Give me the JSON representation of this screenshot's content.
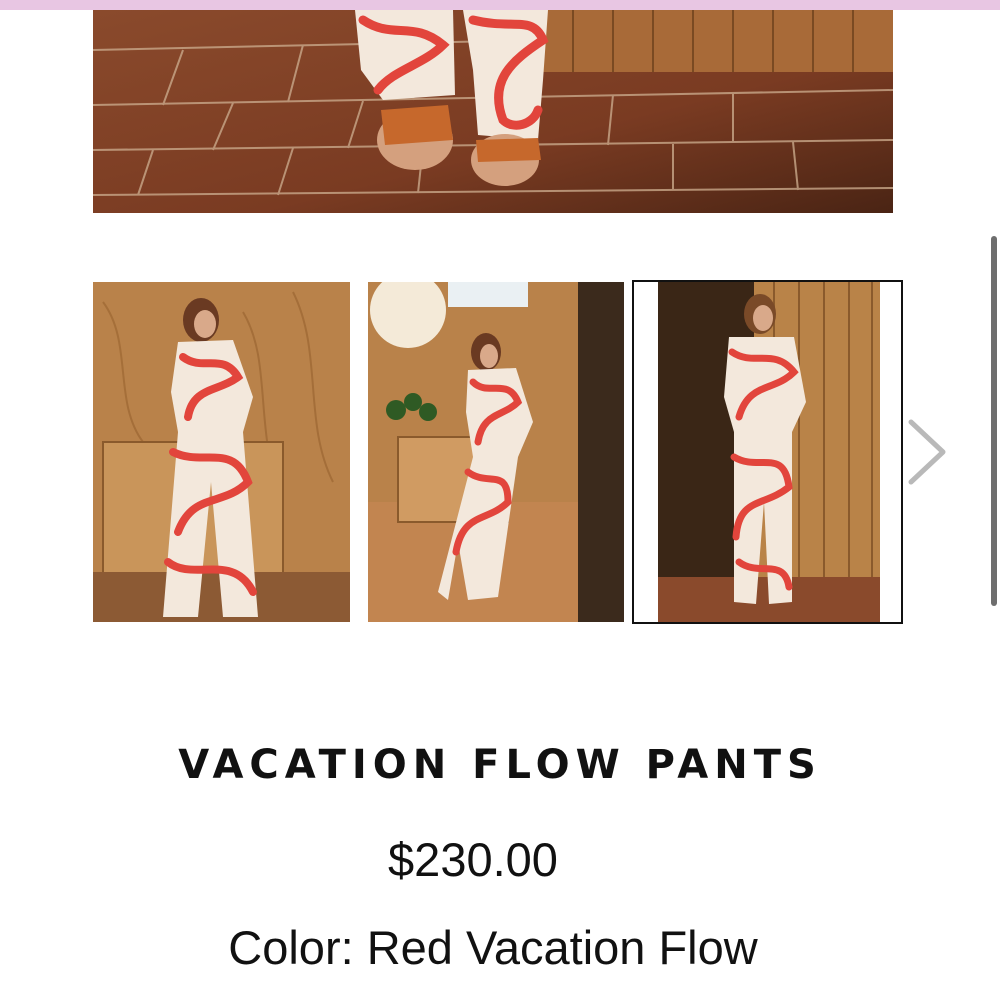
{
  "product": {
    "title": "VACATION FLOW PANTS",
    "price": "$230.00",
    "color_label": "Color:",
    "color_value": "Red Vacation Flow"
  },
  "gallery": {
    "selected_index": 2,
    "next_icon": "chevron-right-icon",
    "thumbnails": [
      {
        "name": "thumbnail-1"
      },
      {
        "name": "thumbnail-2"
      },
      {
        "name": "thumbnail-3"
      }
    ]
  },
  "colors": {
    "accent_bar": "#e8c6e3",
    "print_red": "#e2453c",
    "print_cream": "#f3e8dc",
    "wood": "#b9824a"
  }
}
